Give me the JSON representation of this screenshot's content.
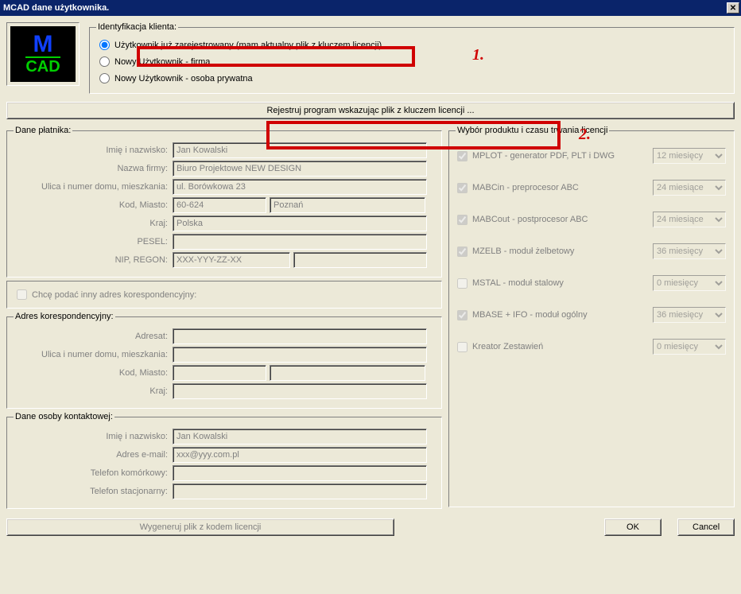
{
  "window": {
    "title": "MCAD dane użytkownika."
  },
  "logo": {
    "line1": "M",
    "line2": "CAD"
  },
  "annotations": {
    "one": "1.",
    "two": "2."
  },
  "ident": {
    "legend": "Identyfikacja klienta:",
    "opt_registered": "Użytkownik już zarejestrowany (mam aktualny plik z kluczem licencji)",
    "opt_firm": "Nowy Użytkownik - firma",
    "opt_priv": "Nowy Użytkownik - osoba prywatna"
  },
  "register_button": "Rejestruj program wskazując plik z kluczem licencji ...",
  "payer": {
    "legend": "Dane płatnika:",
    "name_label": "Imię i nazwisko:",
    "name_value": "Jan Kowalski",
    "company_label": "Nazwa firmy:",
    "company_value": "Biuro Projektowe NEW DESIGN",
    "street_label": "Ulica i numer domu, mieszkania:",
    "street_value": "ul. Borówkowa 23",
    "kodmiasto_label": "Kod, Miasto:",
    "kod_value": "60-624",
    "miasto_value": "Poznań",
    "kraj_label": "Kraj:",
    "kraj_value": "Polska",
    "pesel_label": "PESEL:",
    "pesel_value": "",
    "nip_label": "NIP, REGON:",
    "nip_value": "XXX-YYY-ZZ-XX",
    "nip2_value": ""
  },
  "chk_other_addr": "Chcę podać inny adres korespondencyjny:",
  "addr": {
    "legend": "Adres korespondencyjny:",
    "adresat_label": "Adresat:",
    "street_label": "Ulica i numer domu, mieszkania:",
    "kodmiasto_label": "Kod, Miasto:",
    "kraj_label": "Kraj:"
  },
  "contact": {
    "legend": "Dane osoby kontaktowej:",
    "name_label": "Imię i nazwisko:",
    "name_value": "Jan Kowalski",
    "email_label": "Adres e-mail:",
    "email_value": "xxx@yyy.com.pl",
    "mobile_label": "Telefon komórkowy:",
    "mobile_value": "",
    "phone_label": "Telefon stacjonarny:",
    "phone_value": ""
  },
  "products": {
    "legend": "Wybór produktu i czasu trwania licencji",
    "items": [
      {
        "label": "MPLOT - generator PDF, PLT i DWG",
        "checked": true,
        "duration": "12 miesięcy"
      },
      {
        "label": "MABCin - preprocesor ABC",
        "checked": true,
        "duration": "24 miesiące"
      },
      {
        "label": "MABCout - postprocesor ABC",
        "checked": true,
        "duration": "24 miesiące"
      },
      {
        "label": "MZELB - moduł żelbetowy",
        "checked": true,
        "duration": "36 miesięcy"
      },
      {
        "label": "MSTAL - moduł stalowy",
        "checked": false,
        "duration": "0 miesięcy"
      },
      {
        "label": "MBASE + IFO - moduł ogólny",
        "checked": true,
        "duration": "36 miesięcy"
      },
      {
        "label": "Kreator Zestawień",
        "checked": false,
        "duration": "0 miesięcy"
      }
    ]
  },
  "bottom": {
    "generate": "Wygeneruj plik z kodem licencji",
    "ok": "OK",
    "cancel": "Cancel"
  }
}
